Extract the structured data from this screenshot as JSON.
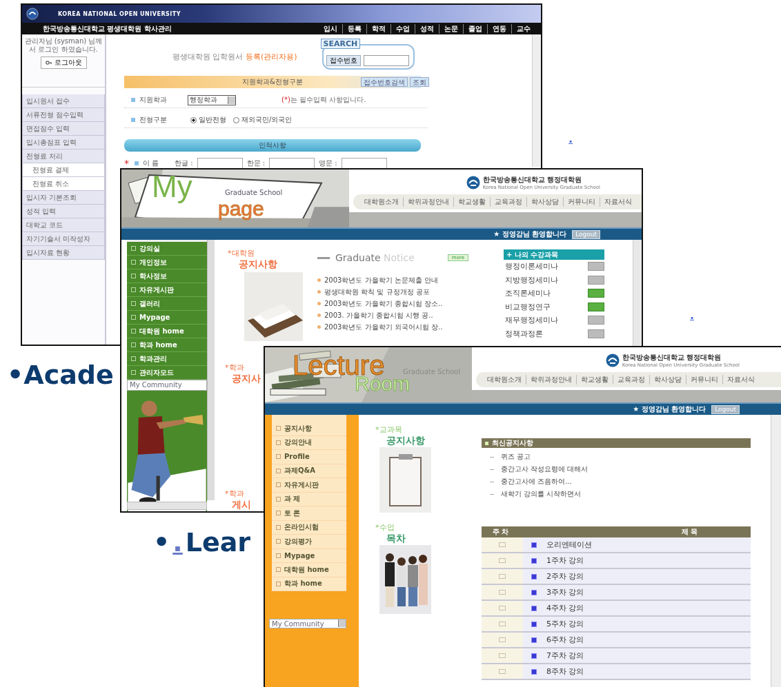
{
  "slide": {
    "bullets": [
      {
        "marker": "•",
        "text": "Acade"
      },
      {
        "marker": "•",
        "link": ".",
        "text": "Lear"
      }
    ],
    "stray_links": [
      ".",
      "."
    ]
  },
  "admin_window": {
    "brand": "KOREA NATIONAL OPEN UNIVERSITY",
    "subtitle": "한국방송통신대학교 평생대학원 학사관리",
    "nav": [
      "입시",
      "등록",
      "학적",
      "수업",
      "성적",
      "논문",
      "졸업",
      "연동",
      "교수"
    ],
    "login_message": "관리자님 (sysman) 님께서 로그인 하였습니다.",
    "logout_button": "로그아웃",
    "menu": [
      {
        "label": "입시원서 접수"
      },
      {
        "label": "서류전형 점수입력"
      },
      {
        "label": "면접점수 입력"
      },
      {
        "label": "입시총점표 입력"
      },
      {
        "label": "전형료 처리",
        "children": [
          {
            "label": "전형료 결제"
          },
          {
            "label": "전형료 취소"
          }
        ]
      },
      {
        "label": "입시자 기본조회"
      },
      {
        "label": "성적 입력"
      },
      {
        "label": "대학교 코드"
      },
      {
        "label": "자기기술서 미작성자"
      },
      {
        "label": "입시자료 현황"
      }
    ],
    "title": {
      "text": "평생대학원 입학원서",
      "highlight": "등록(관리자용)"
    },
    "search": {
      "label": "SEARCH",
      "button": "접수번호"
    },
    "section_bar": {
      "title": "지원학과&전형구분",
      "buttons": [
        "접수번호검색",
        "조회"
      ]
    },
    "department": {
      "label": "지원학과",
      "value": "행정학과",
      "note_mark": "(*)",
      "note": "는 필수입력 사항입니다."
    },
    "admission_type": {
      "label": "전형구분",
      "options": [
        {
          "label": "일반전형",
          "selected": true
        },
        {
          "label": "재외국민/외국인",
          "selected": false
        }
      ]
    },
    "personal_bar": "인적사항",
    "name_row": {
      "required": "*",
      "label": "이 름",
      "fields": [
        "한글 :",
        "한문 :",
        "영문 :"
      ]
    }
  },
  "mypage_window": {
    "logo": {
      "big": "My",
      "small": "page",
      "tag": "Graduate School"
    },
    "university": {
      "name": "한국방송통신대학교 행정대학원",
      "english": "Korea National Open University Graduate School"
    },
    "nav": [
      "대학원소개",
      "학위과정안내",
      "학교생활",
      "교육과정",
      "학사상담",
      "커뮤니티",
      "자료서식"
    ],
    "welcome": "★ 정영감님 환영합니다",
    "logout": "Logout",
    "menu": [
      "강의실",
      "개인정보",
      "학사정보",
      "자유게시판",
      "갤러리",
      "Mypage",
      "대학원 home",
      "학과 home",
      "학과관리",
      "관리자모드"
    ],
    "community": "My Community",
    "notice": {
      "kicker": "*대학원",
      "title": "공지사항",
      "heading": "Graduate",
      "heading_light": "Notice",
      "more": "more",
      "items": [
        "2003학년도 가을학기 논문제출 안내",
        "평생대학원 학칙 및 규정개정 공포",
        "2003학년도 가을학기 종합시험 장소..",
        "2003. 가을학기 종합시험 시행 공..",
        "2003학년도 가을학기 외국어시험 장.."
      ]
    },
    "courses": {
      "title": "+ 나의 수강과목",
      "items": [
        {
          "name": "행정이론세미나",
          "active": false
        },
        {
          "name": "지방행정세미나",
          "active": false
        },
        {
          "name": "조직론세미나",
          "active": true
        },
        {
          "name": "비교행정연구",
          "active": true
        },
        {
          "name": "재무행정세미나",
          "active": false
        },
        {
          "name": "정책과정론",
          "active": false
        }
      ]
    },
    "dept_sections": [
      {
        "kicker": "*학과",
        "title": "공지사"
      },
      {
        "kicker": "*학과",
        "title": "게시"
      }
    ]
  },
  "lecture_window": {
    "logo": {
      "big": "Lecture",
      "small": "Room",
      "tag": "Graduate School"
    },
    "university": {
      "name": "한국방송통신대학교 행정대학원",
      "english": "Korea National Open University Graduate School"
    },
    "nav": [
      "대학원소개",
      "학위과정안내",
      "학교생활",
      "교육과정",
      "학사상담",
      "커뮤니티",
      "자료서식"
    ],
    "welcome": "★ 정영감님 환영합니다",
    "logout": "Logout",
    "menu": [
      "공지사항",
      "강의안내",
      "Profile",
      "과제Q&A",
      "자유게시판",
      "과 제",
      "토 론",
      "온라인시험",
      "강의평가",
      "Mypage",
      "대학원 home",
      "학과 home"
    ],
    "community": "My Community",
    "notice": {
      "kicker": "*교과목",
      "title": "공지사항",
      "bar": "최신공지사항",
      "items": [
        "퀴즈 공고",
        "중간고사 작성요령에 대해서",
        "중간고사에 즈음하여...",
        "새학기 강의를 시작하면서"
      ]
    },
    "syllabus": {
      "kicker": "*수업",
      "title": "목차",
      "columns": [
        "주 차",
        "제 목"
      ],
      "rows": [
        "오리엔테이션",
        "1주차 강의",
        "2주차 강의",
        "3주차 강의",
        "4주차 강의",
        "5주차 강의",
        "6주차 강의",
        "7주차 강의",
        "8주차 강의"
      ]
    }
  }
}
